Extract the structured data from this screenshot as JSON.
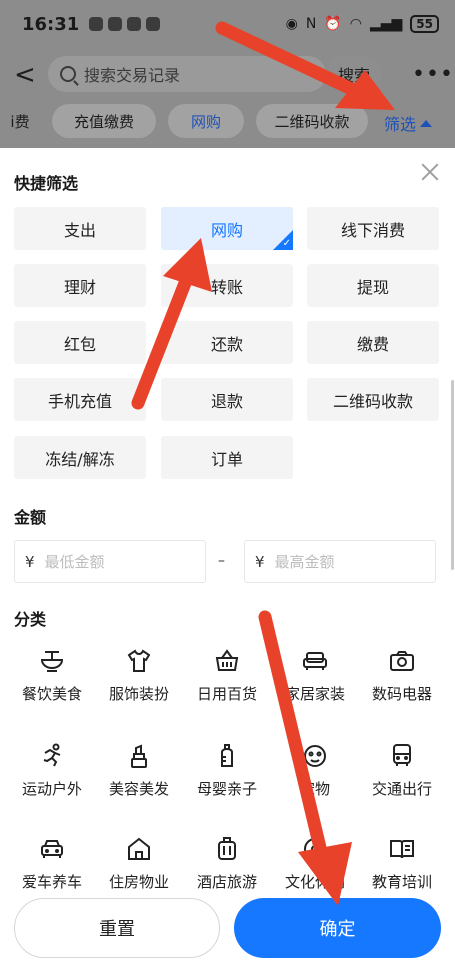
{
  "status_bar": {
    "time": "16:31",
    "battery": "55"
  },
  "search": {
    "placeholder": "搜索交易记录",
    "button": "搜索"
  },
  "tabs": [
    {
      "label": "i费"
    },
    {
      "label": "充值缴费"
    },
    {
      "label": "网购"
    },
    {
      "label": "二维码收款"
    }
  ],
  "filter_tab": {
    "label": "筛选"
  },
  "sheet": {
    "quick_title": "快捷筛选",
    "quick_filters": [
      {
        "label": "支出",
        "selected": false
      },
      {
        "label": "网购",
        "selected": true
      },
      {
        "label": "线下消费",
        "selected": false
      },
      {
        "label": "理财",
        "selected": false
      },
      {
        "label": "转账",
        "selected": false
      },
      {
        "label": "提现",
        "selected": false
      },
      {
        "label": "红包",
        "selected": false
      },
      {
        "label": "还款",
        "selected": false
      },
      {
        "label": "缴费",
        "selected": false
      },
      {
        "label": "手机充值",
        "selected": false
      },
      {
        "label": "退款",
        "selected": false
      },
      {
        "label": "二维码收款",
        "selected": false
      },
      {
        "label": "冻结/解冻",
        "selected": false
      },
      {
        "label": "订单",
        "selected": false
      }
    ],
    "amount_title": "金额",
    "amount_min_placeholder": "最低金额",
    "amount_max_placeholder": "最高金额",
    "currency": "¥",
    "amount_separator": "–",
    "category_title": "分类",
    "categories": [
      {
        "label": "餐饮美食",
        "icon": "bowl-icon"
      },
      {
        "label": "服饰装扮",
        "icon": "shirt-icon"
      },
      {
        "label": "日用百货",
        "icon": "basket-icon"
      },
      {
        "label": "家居家装",
        "icon": "sofa-icon"
      },
      {
        "label": "数码电器",
        "icon": "camera-icon"
      },
      {
        "label": "运动户外",
        "icon": "runner-icon"
      },
      {
        "label": "美容美发",
        "icon": "lipstick-icon"
      },
      {
        "label": "母婴亲子",
        "icon": "baby-bottle-icon"
      },
      {
        "label": "宠物",
        "icon": "paw-icon"
      },
      {
        "label": "交通出行",
        "icon": "bus-icon"
      },
      {
        "label": "爱车养车",
        "icon": "car-icon"
      },
      {
        "label": "住房物业",
        "icon": "house-icon"
      },
      {
        "label": "酒店旅游",
        "icon": "luggage-icon"
      },
      {
        "label": "文化休闲",
        "icon": "film-icon"
      },
      {
        "label": "教育培训",
        "icon": "book-icon"
      }
    ]
  },
  "footer": {
    "reset": "重置",
    "confirm": "确定"
  },
  "colors": {
    "accent": "#1677ff",
    "selected_bg": "#e3efff",
    "annotation_arrow": "#e8422a"
  }
}
